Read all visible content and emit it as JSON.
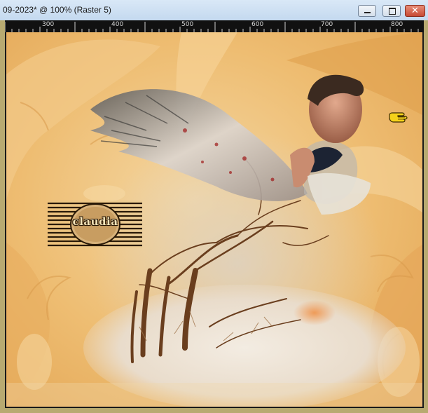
{
  "window": {
    "title": "09-2023* @ 100% (Raster 5)",
    "minimize_label": "minimize",
    "maximize_label": "maximize",
    "close_label": "✕"
  },
  "ruler": {
    "labels": [
      "300",
      "400",
      "500",
      "600",
      "700",
      "800"
    ]
  },
  "watermark": {
    "text": "claudia"
  },
  "colors": {
    "canvas_base": "#e9b767",
    "frame": "#c9be8f",
    "ruler_bg": "#111111"
  },
  "cursor": {
    "icon": "pointing-hand-icon"
  }
}
